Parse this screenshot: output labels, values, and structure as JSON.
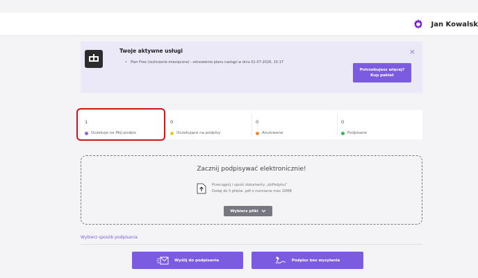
{
  "header": {
    "user_name": "Jan Kowalsk",
    "icon": "gear-icon",
    "icon_color": "#7a1fd8"
  },
  "services": {
    "title": "Twoje aktywne usługi",
    "plan_text": "Plan Free (rozliczenie miesięczne) - odnowienie planu nastąpi w dniu 01-07-2026, 15:17",
    "close_label": "×",
    "buy_line1": "Potrzebujesz więcej?",
    "buy_line2": "Kup pakiet",
    "logo": "dp-logo-icon"
  },
  "stats": [
    {
      "count": "1",
      "label": "Oczekuje na Mój podpis",
      "color": "#8a67e0"
    },
    {
      "count": "0",
      "label": "Oczekujące na podpisy",
      "color": "#e8c72a"
    },
    {
      "count": "0",
      "label": "Anulowane",
      "color": "#f08a2b"
    },
    {
      "count": "0",
      "label": "Podpisane",
      "color": "#36b54a"
    }
  ],
  "upload": {
    "title": "Zacznij podpisywać elektronicznie!",
    "line1": "Przeciągnij i upuść dokumenty „doPodpisu”",
    "line2": "Dodaj do 5 plików .pdf o rozmiarze max 20MB",
    "pick_label": "Wybierz pliki",
    "icon": "upload-icon"
  },
  "method": {
    "label": "Wybierz sposób podpisania"
  },
  "actions": {
    "send_label": "Wyślij do podpisania",
    "sign_label": "Podpisz bez wysyłania"
  },
  "colors": {
    "accent": "#7b5ce0",
    "highlight": "#d0121b"
  }
}
